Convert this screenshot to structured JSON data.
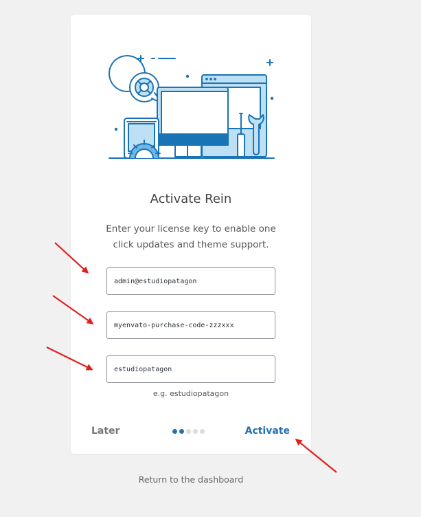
{
  "card": {
    "title": "Activate Rein",
    "description": "Enter your license key to enable one click updates and theme support."
  },
  "form": {
    "username_value": "admin@estudiopatagon",
    "purchase_code_value": "myenvato-purchase-code-zzzxxx",
    "third_field_value": "estudiopatagon",
    "hint": "e.g. estudiopatagon"
  },
  "footer": {
    "later_label": "Later",
    "activate_label": "Activate",
    "step_count": 5,
    "active_steps": 2
  },
  "return_link": "Return to the dashboard",
  "colors": {
    "accent": "#2271b1",
    "illustration_light": "#bde0f5",
    "illustration_dark": "#1a73b5",
    "annotation_arrow": "#e01f1f"
  },
  "icons": [
    "support-lifebuoy-icon",
    "monitor-icon",
    "phone-icon",
    "gear-icon",
    "screwdriver-icon",
    "wrench-icon",
    "browser-window-icon"
  ]
}
